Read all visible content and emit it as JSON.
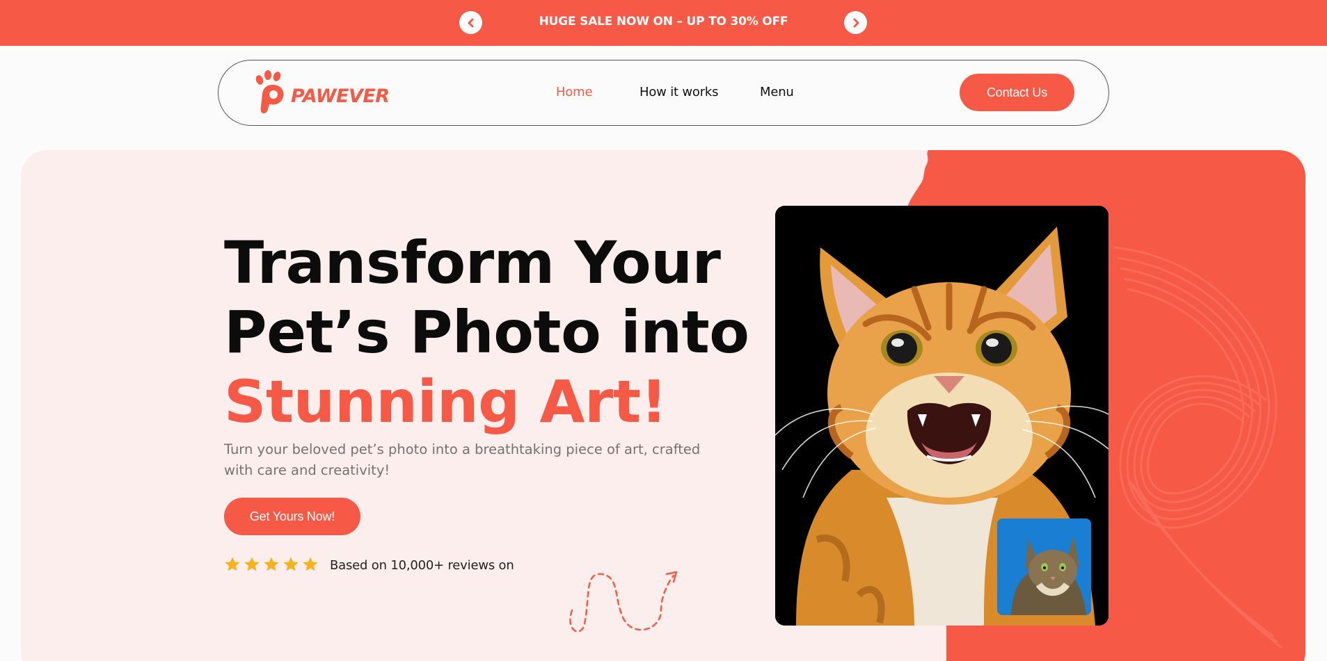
{
  "promo": {
    "text": "HUGE SALE NOW ON – UP TO 30% OFF",
    "prev_icon": "chevron-left-icon",
    "next_icon": "chevron-right-icon"
  },
  "nav": {
    "logo_text": "PAWEVER",
    "links": [
      "Home",
      "How it works",
      "Menu"
    ],
    "active": "Home",
    "contact_label": "Contact Us"
  },
  "hero": {
    "headline_line1": "Transform Your",
    "headline_line2": "Pet’s Photo into",
    "headline_accent": "Stunning Art!",
    "subtext": "Turn your beloved pet’s photo into a breathtaking piece of art, crafted with care and creativity!",
    "cta_label": "Get Yours Now!",
    "rating_stars": 5,
    "reviews_text": "Based on 10,000+ reviews on"
  },
  "colors": {
    "accent": "#f65945",
    "hero_bg": "#fbeeec",
    "star": "#f6b21e"
  }
}
